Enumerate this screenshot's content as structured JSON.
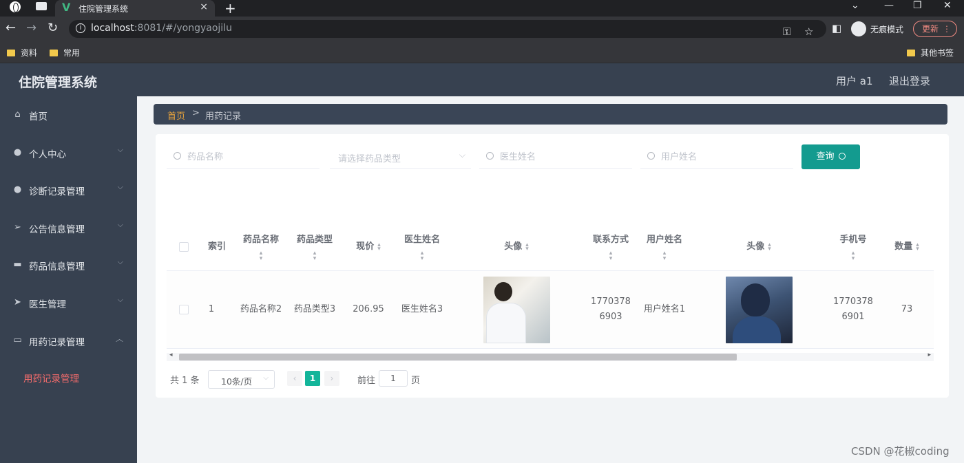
{
  "browser": {
    "tab_title": "住院管理系统",
    "tab_close": "×",
    "new_tab": "+",
    "url_host": "localhost",
    "url_rest": ":8081/#/yongyaojilu",
    "incognito_label": "无痕模式",
    "update_label": "更新",
    "bookmarks": [
      "资料",
      "常用"
    ],
    "other_bookmarks": "其他书签"
  },
  "header": {
    "title": "住院管理系统",
    "user": "用户 a1",
    "logout": "退出登录"
  },
  "sidebar": {
    "items": [
      {
        "label": "首页",
        "icon": "home-icon"
      },
      {
        "label": "个人中心",
        "icon": "user-icon"
      },
      {
        "label": "诊断记录管理",
        "icon": "user-icon"
      },
      {
        "label": "公告信息管理",
        "icon": "send-icon"
      },
      {
        "label": "药品信息管理",
        "icon": "briefcase-icon"
      },
      {
        "label": "医生管理",
        "icon": "send-icon"
      },
      {
        "label": "用药记录管理",
        "icon": "chat-icon"
      }
    ],
    "active_sub": "用药记录管理"
  },
  "breadcrumb": {
    "home": "首页",
    "sep": ">",
    "current": "用药记录"
  },
  "filters": {
    "drug_name_placeholder": "药品名称",
    "drug_type_placeholder": "请选择药品类型",
    "doctor_name_placeholder": "医生姓名",
    "user_name_placeholder": "用户姓名",
    "search_label": "查询"
  },
  "table": {
    "headers": {
      "index": "索引",
      "drug_name": "药品名称",
      "drug_type": "药品类型",
      "price": "现价",
      "doctor_name": "医生姓名",
      "doctor_avatar": "头像",
      "contact": "联系方式",
      "user_name": "用户姓名",
      "user_avatar": "头像",
      "phone": "手机号",
      "quantity": "数量"
    },
    "row": {
      "index": "1",
      "drug_name": "药品名称2",
      "drug_type": "药品类型3",
      "price": "206.95",
      "doctor_name": "医生姓名3",
      "contact": "17703786903",
      "user_name": "用户姓名1",
      "phone": "17703786901",
      "quantity": "73"
    }
  },
  "pagination": {
    "total": "共 1 条",
    "page_size": "10条/页",
    "current": "1",
    "goto_label": "前往",
    "goto_value": "1",
    "page_suffix": "页"
  },
  "watermark": "CSDN @花椒coding",
  "colors": {
    "header_bg": "#374150",
    "accent": "#139b8f",
    "active_menu": "#f56c6c",
    "breadcrumb_home": "#e6a23c"
  }
}
